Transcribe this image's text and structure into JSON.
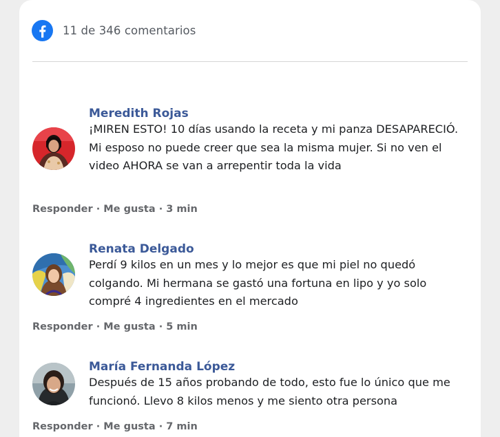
{
  "header": {
    "icon": "facebook-icon",
    "brand_color": "#1877f2",
    "count_text": "11 de 346 comentarios"
  },
  "comments": [
    {
      "name": "Meredith Rojas",
      "avatar": "avatar-photo",
      "text": "¡MIREN ESTO! 10 días usando la receta y mi panza DESAPARECIÓ. Mi esposo no puede creer que sea la misma mujer. Si no ven el video AHORA se van a arrepentir toda la vida",
      "reply_label": "Responder",
      "like_label": "Me gusta",
      "time": "3 min"
    },
    {
      "name": "Renata Delgado",
      "avatar": "avatar-photo",
      "text": "Perdí 9 kilos en un mes y lo mejor es que mi piel no quedó colgando. Mi hermana se gastó una fortuna en lipo y yo solo compré 4 ingredientes en el mercado",
      "reply_label": "Responder",
      "like_label": "Me gusta",
      "time": "5 min"
    },
    {
      "name": "María Fernanda López",
      "avatar": "avatar-photo",
      "text": "Después de 15 años probando de todo, esto fue lo único que me funcionó. Llevo 8 kilos menos y me siento otra persona",
      "reply_label": "Responder",
      "like_label": "Me gusta",
      "time": "7 min"
    }
  ],
  "colors": {
    "name": "#3b5998",
    "text": "#1c1e21",
    "muted": "#65676b"
  }
}
